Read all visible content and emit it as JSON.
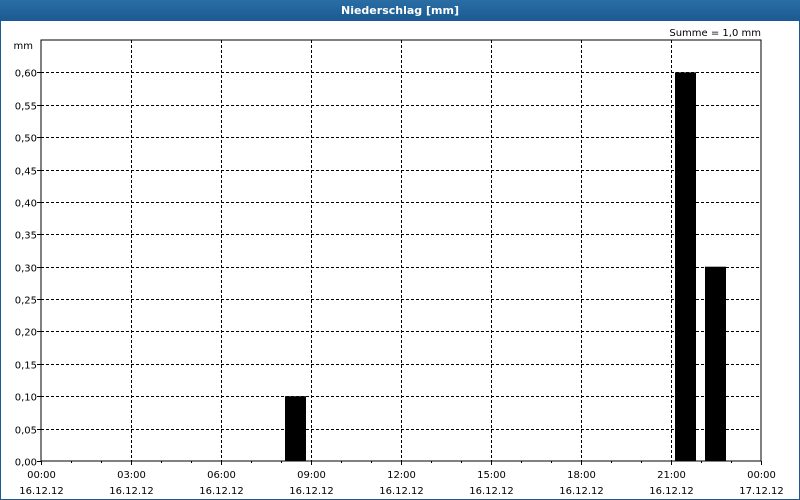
{
  "window": {
    "title": "Niederschlag [mm]"
  },
  "summary": "Summe = 1,0 mm",
  "chart_data": {
    "type": "bar",
    "title": "Niederschlag [mm]",
    "ylabel": "mm",
    "xlabel": "",
    "ylim": [
      0,
      0.65
    ],
    "xlim_hours": [
      0,
      24
    ],
    "y_ticks": [
      "0,00",
      "0,05",
      "0,10",
      "0,15",
      "0,20",
      "0,25",
      "0,30",
      "0,35",
      "0,40",
      "0,45",
      "0,50",
      "0,55",
      "0,60"
    ],
    "x_ticks": [
      {
        "time": "00:00",
        "date": "16.12.12"
      },
      {
        "time": "03:00",
        "date": "16.12.12"
      },
      {
        "time": "06:00",
        "date": "16.12.12"
      },
      {
        "time": "09:00",
        "date": "16.12.12"
      },
      {
        "time": "12:00",
        "date": "16.12.12"
      },
      {
        "time": "15:00",
        "date": "16.12.12"
      },
      {
        "time": "18:00",
        "date": "16.12.12"
      },
      {
        "time": "21:00",
        "date": "16.12.12"
      },
      {
        "time": "00:00",
        "date": "17.12.12"
      }
    ],
    "grid": true,
    "bars": [
      {
        "time": "08:00–09:00",
        "value": 0.1
      },
      {
        "time": "21:00–22:00",
        "value": 0.6
      },
      {
        "time": "22:00–23:00",
        "value": 0.3
      }
    ],
    "bar_color": "#000000"
  }
}
